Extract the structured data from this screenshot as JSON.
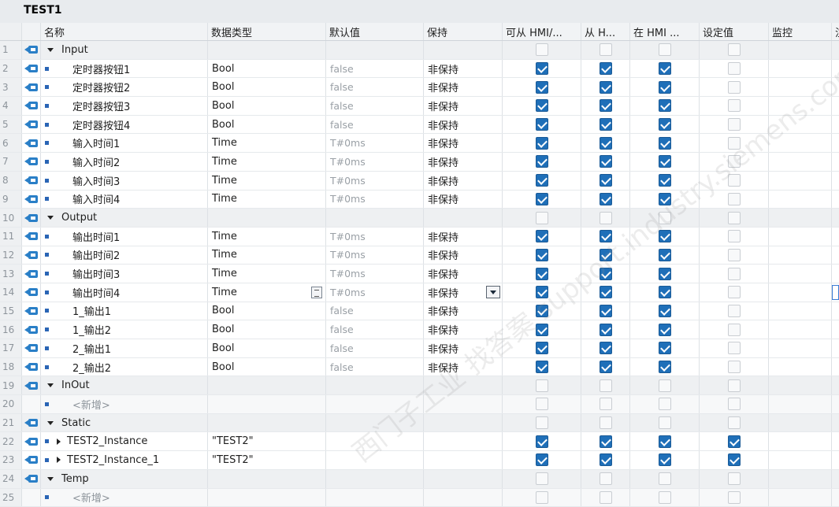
{
  "block_title": "TEST1",
  "columns": {
    "name": "名称",
    "datatype": "数据类型",
    "default": "默认值",
    "retain": "保持",
    "hmi_accessible": "可从 HMI/...",
    "hmi_visible": "从 H...",
    "hmi_setpoint": "在 HMI ...",
    "setpoint": "设定值",
    "monitor": "监控",
    "comment": "注"
  },
  "watermark": "西门子工业 找答案 support.industry.siemens.com/cs",
  "rows": [
    {
      "num": "1",
      "kind": "section",
      "name": "Input",
      "hmi": [
        false,
        false,
        false,
        false
      ]
    },
    {
      "num": "2",
      "kind": "data",
      "name": "定时器按钮1",
      "type": "Bool",
      "default": "false",
      "retain": "非保持",
      "hmi": [
        true,
        true,
        true,
        false
      ]
    },
    {
      "num": "3",
      "kind": "data",
      "name": "定时器按钮2",
      "type": "Bool",
      "default": "false",
      "retain": "非保持",
      "hmi": [
        true,
        true,
        true,
        false
      ]
    },
    {
      "num": "4",
      "kind": "data",
      "name": "定时器按钮3",
      "type": "Bool",
      "default": "false",
      "retain": "非保持",
      "hmi": [
        true,
        true,
        true,
        false
      ]
    },
    {
      "num": "5",
      "kind": "data",
      "name": "定时器按钮4",
      "type": "Bool",
      "default": "false",
      "retain": "非保持",
      "hmi": [
        true,
        true,
        true,
        false
      ]
    },
    {
      "num": "6",
      "kind": "data",
      "name": "输入时间1",
      "type": "Time",
      "default": "T#0ms",
      "retain": "非保持",
      "hmi": [
        true,
        true,
        true,
        false
      ]
    },
    {
      "num": "7",
      "kind": "data",
      "name": "输入时间2",
      "type": "Time",
      "default": "T#0ms",
      "retain": "非保持",
      "hmi": [
        true,
        true,
        true,
        false
      ]
    },
    {
      "num": "8",
      "kind": "data",
      "name": "输入时间3",
      "type": "Time",
      "default": "T#0ms",
      "retain": "非保持",
      "hmi": [
        true,
        true,
        true,
        false
      ]
    },
    {
      "num": "9",
      "kind": "data",
      "name": "输入时间4",
      "type": "Time",
      "default": "T#0ms",
      "retain": "非保持",
      "hmi": [
        true,
        true,
        true,
        false
      ]
    },
    {
      "num": "10",
      "kind": "section",
      "name": "Output",
      "hmi": [
        false,
        false,
        false,
        false
      ]
    },
    {
      "num": "11",
      "kind": "data",
      "name": "输出时间1",
      "type": "Time",
      "default": "T#0ms",
      "retain": "非保持",
      "hmi": [
        true,
        true,
        true,
        false
      ]
    },
    {
      "num": "12",
      "kind": "data",
      "name": "输出时间2",
      "type": "Time",
      "default": "T#0ms",
      "retain": "非保持",
      "hmi": [
        true,
        true,
        true,
        false
      ]
    },
    {
      "num": "13",
      "kind": "data",
      "name": "输出时间3",
      "type": "Time",
      "default": "T#0ms",
      "retain": "非保持",
      "hmi": [
        true,
        true,
        true,
        false
      ]
    },
    {
      "num": "14",
      "kind": "data",
      "name": "输出时间4",
      "type": "Time",
      "default": "T#0ms",
      "retain": "非保持",
      "hmi": [
        true,
        true,
        true,
        false
      ],
      "active": true
    },
    {
      "num": "15",
      "kind": "data",
      "name": "1_输出1",
      "type": "Bool",
      "default": "false",
      "retain": "非保持",
      "hmi": [
        true,
        true,
        true,
        false
      ]
    },
    {
      "num": "16",
      "kind": "data",
      "name": "1_输出2",
      "type": "Bool",
      "default": "false",
      "retain": "非保持",
      "hmi": [
        true,
        true,
        true,
        false
      ]
    },
    {
      "num": "17",
      "kind": "data",
      "name": "2_输出1",
      "type": "Bool",
      "default": "false",
      "retain": "非保持",
      "hmi": [
        true,
        true,
        true,
        false
      ]
    },
    {
      "num": "18",
      "kind": "data",
      "name": "2_输出2",
      "type": "Bool",
      "default": "false",
      "retain": "非保持",
      "hmi": [
        true,
        true,
        true,
        false
      ]
    },
    {
      "num": "19",
      "kind": "section",
      "name": "InOut",
      "hmi": [
        false,
        false,
        false,
        false
      ]
    },
    {
      "num": "20",
      "kind": "placeholder",
      "name": "<新增>",
      "hmi": [
        false,
        false,
        false,
        false
      ]
    },
    {
      "num": "21",
      "kind": "section",
      "name": "Static",
      "hmi": [
        false,
        false,
        false,
        false
      ]
    },
    {
      "num": "22",
      "kind": "instance",
      "name": "TEST2_Instance",
      "type": "\"TEST2\"",
      "hmi": [
        true,
        true,
        true,
        true
      ]
    },
    {
      "num": "23",
      "kind": "instance",
      "name": "TEST2_Instance_1",
      "type": "\"TEST2\"",
      "hmi": [
        true,
        true,
        true,
        true
      ]
    },
    {
      "num": "24",
      "kind": "section",
      "name": "Temp",
      "hmi": [
        false,
        false,
        false,
        false
      ]
    },
    {
      "num": "25",
      "kind": "placeholder",
      "name": "<新增>",
      "hmi": [
        false,
        false,
        false,
        false
      ]
    }
  ]
}
